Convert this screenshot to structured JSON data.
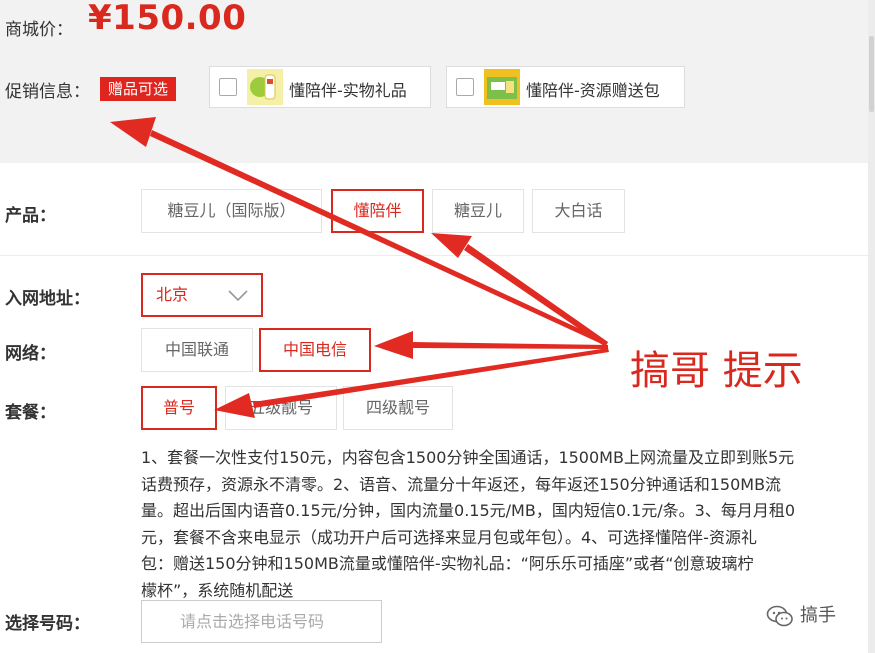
{
  "price": {
    "label": "商城价：",
    "value": "¥150.00"
  },
  "promo": {
    "label": "促销信息：",
    "badge": "赠品可选",
    "gifts": [
      {
        "label": "懂陪伴-实物礼品",
        "checked": false,
        "icon": "gift-product-thumbnail"
      },
      {
        "label": "懂陪伴-资源赠送包",
        "checked": false,
        "icon": "gift-resource-thumbnail"
      }
    ]
  },
  "product": {
    "label": "产品：",
    "options": [
      "糖豆儿（国际版）",
      "懂陪伴",
      "糖豆儿",
      "大白话"
    ],
    "selected": "懂陪伴"
  },
  "address": {
    "label": "入网地址：",
    "value": "北京",
    "icon": "chevron-down-icon"
  },
  "network": {
    "label": "网络：",
    "options": [
      "中国联通",
      "中国电信"
    ],
    "selected": "中国电信"
  },
  "plan": {
    "label": "套餐：",
    "options": [
      "普号",
      "五级靓号",
      "四级靓号"
    ],
    "selected": "普号"
  },
  "description": [
    "1、套餐一次性支付150元，内容包含1500分钟全国通话，1500MB上网流量及立即到账5元",
    "话费预存，资源永不清零。2、语音、流量分十年返还，每年返还150分钟通话和150MB流",
    "量。超出后国内语音0.15元/分钟，国内流量0.15元/MB，国内短信0.1元/条。3、每月月租0",
    "元，套餐不含来电显示（成功开户后可选择来显月包或年包）。4、可选择懂陪伴-资源礼",
    "包：赠送150分钟和150MB流量或懂陪伴-实物礼品：“阿乐乐可插座”或者“创意玻璃柠",
    "檬杯”，系统随机配送"
  ],
  "phone": {
    "label": "选择号码：",
    "placeholder": "请点击选择电话号码"
  },
  "annotation": {
    "text": "搞哥 提示",
    "color": "#d9281e"
  },
  "watermark": {
    "text": "搞手",
    "icon": "wechat-icon"
  },
  "colors": {
    "accent": "#d9281e",
    "badge": "#e0251f",
    "band": "#f2f2f2"
  }
}
